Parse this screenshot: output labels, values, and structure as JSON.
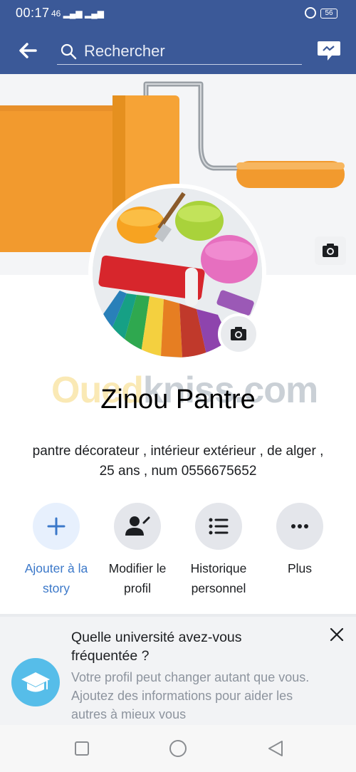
{
  "status": {
    "time": "00:17",
    "signal": "46",
    "battery": "56"
  },
  "search": {
    "placeholder": "Rechercher"
  },
  "watermark": {
    "part1": "Oued",
    "part2": "kniss.com"
  },
  "profile": {
    "name": "Zinou Pantre",
    "bio": "pantre décorateur , intérieur extérieur , de alger , 25 ans , num 0556675652"
  },
  "actions": [
    {
      "label": "Ajouter à la story",
      "icon": "plus-icon"
    },
    {
      "label": "Modifier le profil",
      "icon": "edit-profile-icon"
    },
    {
      "label": "Historique personnel",
      "icon": "list-icon"
    },
    {
      "label": "Plus",
      "icon": "more-icon"
    }
  ],
  "card": {
    "question": "Quelle université avez-vous fréquentée ?",
    "description": "Votre profil peut changer autant que vous. Ajoutez des informations pour aider les autres à mieux vous"
  },
  "colors": {
    "brand": "#3b5998",
    "accent": "#3b78c9",
    "paint": "#f29a2e"
  }
}
